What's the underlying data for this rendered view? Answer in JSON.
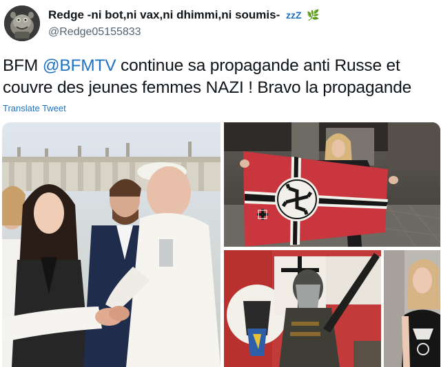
{
  "author": {
    "display_name": "Redge -ni bot,ni vax,ni dhimmi,ni soumis-",
    "name_decor_sleep": "zzZ",
    "name_decor_leaf": "🌿",
    "handle": "@Redge05155833",
    "avatar_icon": "goblin-avatar-icon"
  },
  "tweet": {
    "text_before_mention": "BFM ",
    "mention": "@BFMTV",
    "text_line1_rest": " continue sa propagande anti Russe et",
    "text_line2": "couvre des jeunes femmes NAZI ! Bravo la propagande",
    "translate_label": "Translate Tweet",
    "mention_color": "#1d72c4"
  },
  "media": {
    "photo_count": 4,
    "photos": [
      {
        "description_name": "pope-handshake-photo"
      },
      {
        "description_name": "woman-holding-flag-in-ruins-photo"
      },
      {
        "description_name": "armed-masked-person-with-flags-photo"
      },
      {
        "description_name": "woman-in-tank-top-photo"
      }
    ]
  }
}
